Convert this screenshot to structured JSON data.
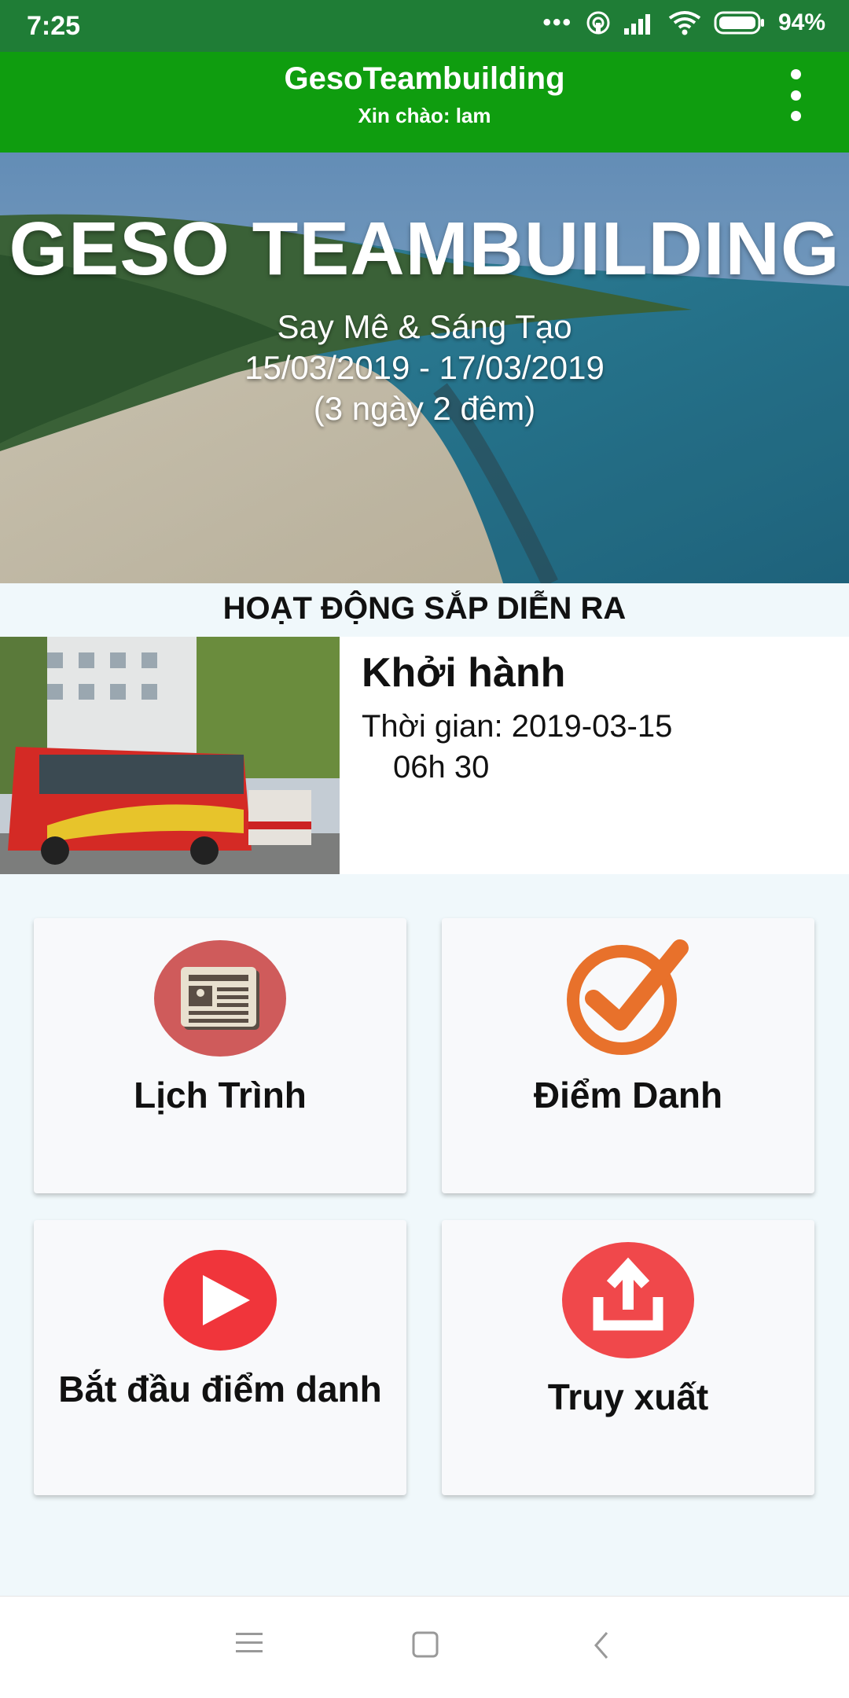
{
  "status_bar": {
    "time": "7:25",
    "battery": "94%",
    "icons": [
      "more-dots-icon",
      "hotspot-icon",
      "signal-icon",
      "wifi-icon",
      "battery-icon"
    ]
  },
  "app_bar": {
    "title": "GesoTeambuilding",
    "greeting": "Xin chào:  lam",
    "menu_icon": "more-vert-icon",
    "color": "#0f9d0f"
  },
  "hero": {
    "title": "GESO TEAMBUILDING",
    "slogan": "Say Mê & Sáng Tạo",
    "dates": "15/03/2019 - 17/03/2019",
    "duration": "(3 ngày 2 đêm)"
  },
  "upcoming": {
    "section_title": "HOẠT ĐỘNG SẮP DIỄN RA",
    "event": {
      "name": "Khởi hành",
      "time_line": "Thời gian: 2019-03-15",
      "hour": "06h 30"
    }
  },
  "menu": [
    {
      "label": "Lịch Trình",
      "icon": "newspaper-icon",
      "color": "#cf5b5b"
    },
    {
      "label": "Điểm Danh",
      "icon": "checkmark-icon",
      "color": "#e8712b"
    },
    {
      "label": "Bắt đầu điểm danh",
      "icon": "play-icon",
      "color": "#f0353b"
    },
    {
      "label": "Truy xuất",
      "icon": "upload-icon",
      "color": "#f0484b"
    }
  ],
  "nav_bar": {
    "icons": [
      "menu-icon",
      "home-square-icon",
      "back-icon"
    ]
  }
}
